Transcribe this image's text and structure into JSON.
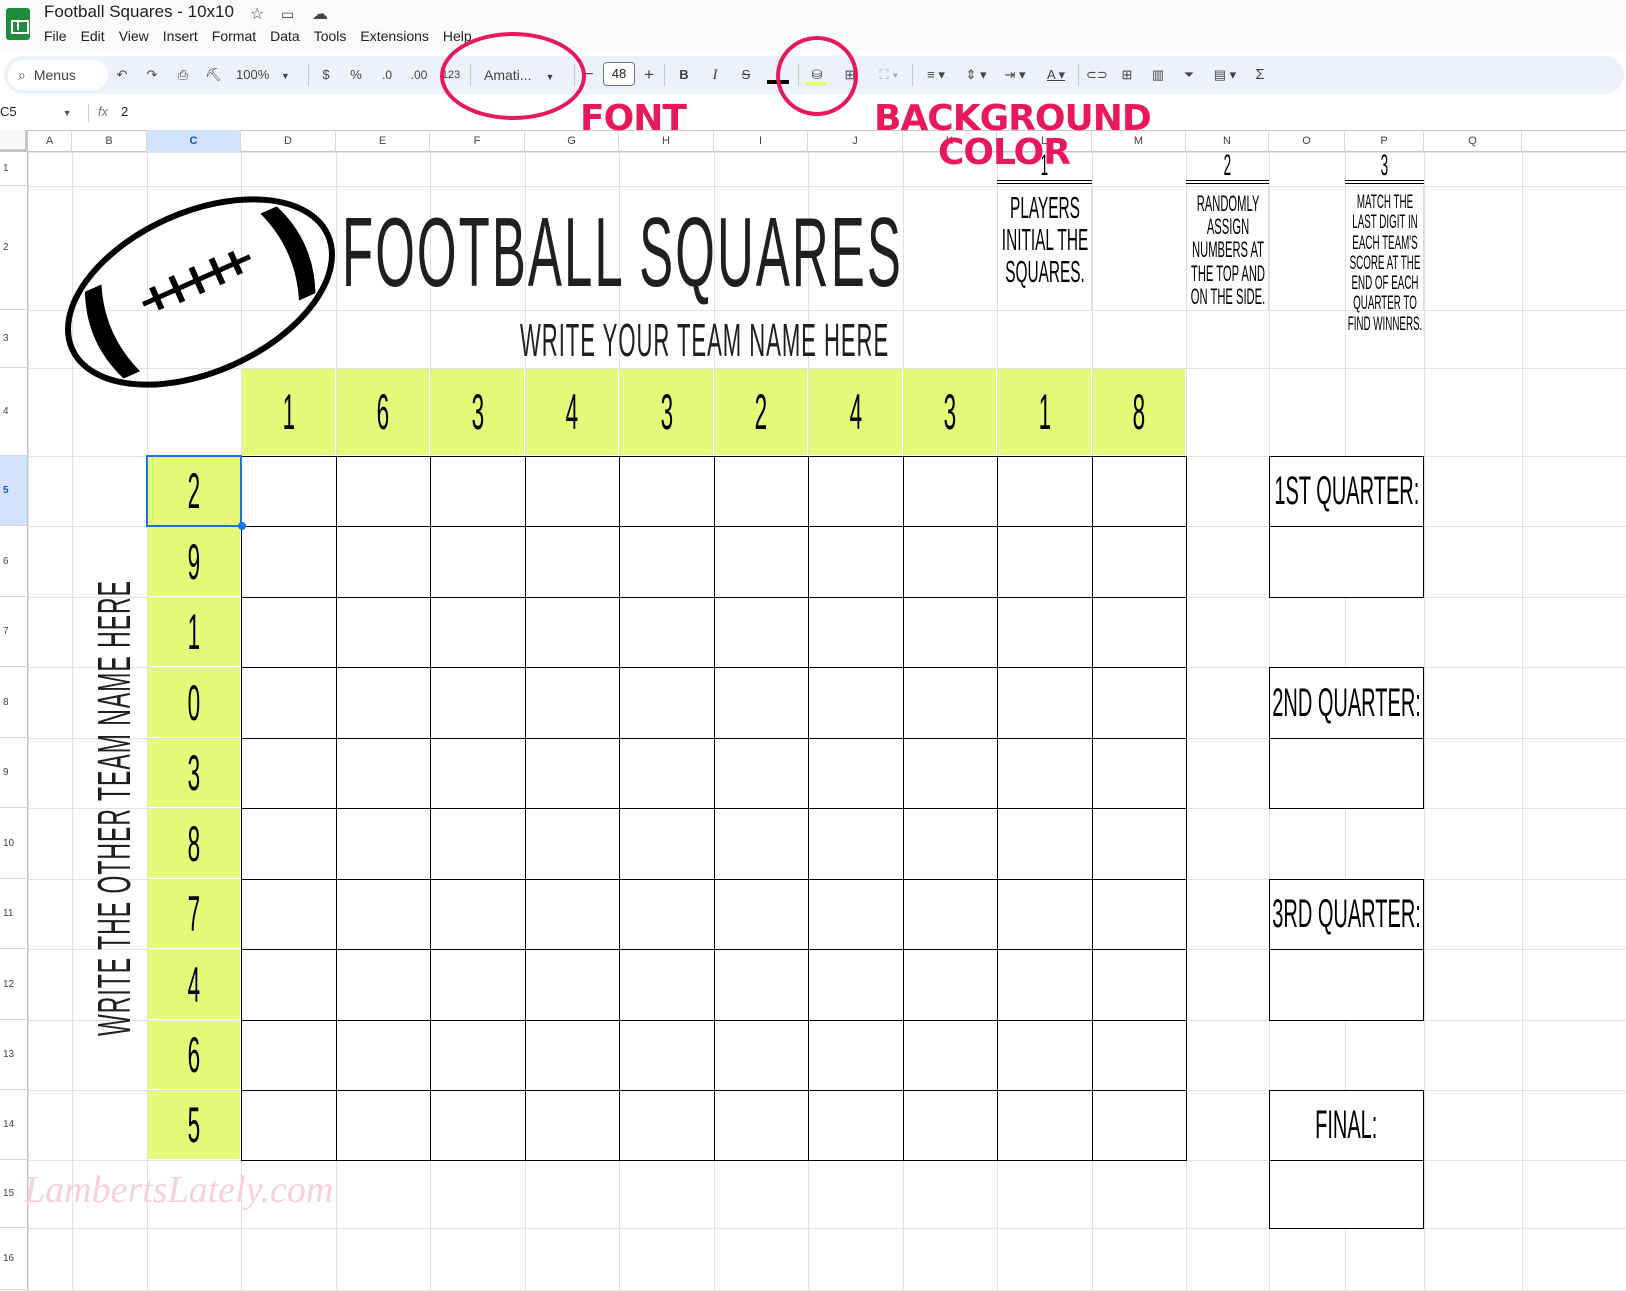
{
  "app": {
    "doc_title": "Football Squares - 10x10",
    "title_icons": [
      "star-icon",
      "move-to-folder-icon",
      "cloud-saved-icon"
    ],
    "menu": [
      "File",
      "Edit",
      "View",
      "Insert",
      "Format",
      "Data",
      "Tools",
      "Extensions",
      "Help"
    ]
  },
  "toolbar": {
    "search_label": "Menus",
    "zoom": "100%",
    "currency": "$",
    "percent": "%",
    "decrease_decimal": ".0",
    "increase_decimal": ".00",
    "number_format": "123",
    "font": "Amati...",
    "font_size": "48",
    "minus": "−",
    "plus": "+",
    "bold": "B",
    "italic": "I",
    "sum": "Σ"
  },
  "formula_bar": {
    "cell_ref": "C5",
    "fx": "fx",
    "value": "2"
  },
  "grid": {
    "columns": [
      "A",
      "B",
      "C",
      "D",
      "E",
      "F",
      "G",
      "H",
      "I",
      "J",
      "K",
      "L",
      "M",
      "N",
      "O",
      "P",
      "Q"
    ],
    "selected_column": "C",
    "rows": [
      "1",
      "2",
      "3",
      "4",
      "5",
      "6",
      "7",
      "8",
      "9",
      "10",
      "11",
      "12",
      "13",
      "14",
      "15",
      "16"
    ],
    "selected_row": "5"
  },
  "sheet": {
    "title": "Football Squares",
    "team_top": "Write your team name here",
    "team_side": "Write the other team name here",
    "top_numbers": [
      "1",
      "6",
      "3",
      "4",
      "3",
      "2",
      "4",
      "3",
      "1",
      "8"
    ],
    "side_numbers": [
      "2",
      "9",
      "1",
      "0",
      "3",
      "8",
      "7",
      "4",
      "6",
      "5"
    ],
    "steps": [
      {
        "num": "1",
        "text": "Players initial the squares."
      },
      {
        "num": "2",
        "text": "Randomly assign numbers at the top and on the side."
      },
      {
        "num": "3",
        "text": "Match the last digit in each team's score at the end of each quarter to find winners."
      }
    ],
    "quarters": [
      "1st quarter:",
      "2nd quarter:",
      "3rd quarter:",
      "Final:"
    ],
    "watermark": "LambertsLately.com",
    "highlight_color": "#e5fa78"
  },
  "annotations": {
    "font_label": "FONT",
    "bg_label_1": "BACKGROUND",
    "bg_label_2": "COLOR",
    "color": "#e8185a"
  }
}
